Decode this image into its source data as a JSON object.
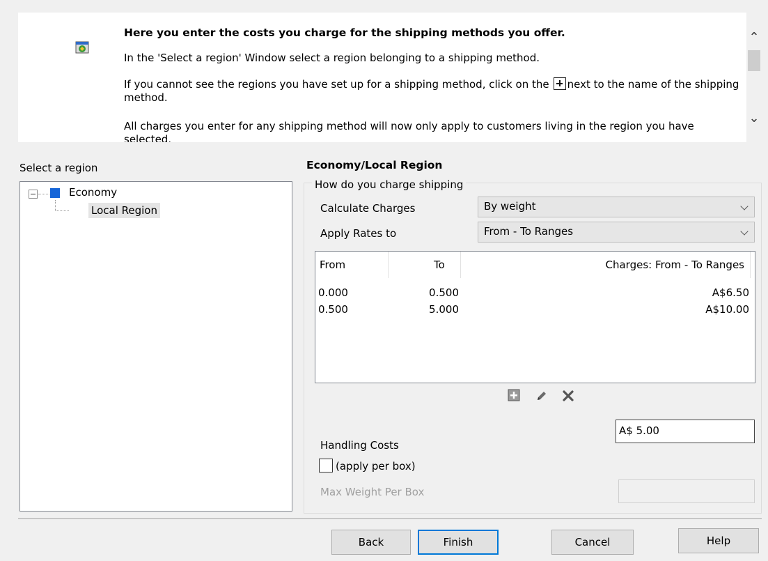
{
  "info": {
    "heading": "Here you enter the costs you charge for the shipping methods you offer.",
    "line_1": "In the 'Select a region' Window select a region belonging to a shipping method.",
    "line_2_before": "If you cannot see the regions you have set up for a shipping method, click on the",
    "line_2_after": "next to the name of the shipping method.",
    "line_3": "All charges you enter for any shipping method will now only apply to customers living in the region you have selected."
  },
  "region_panel": {
    "label": "Select a region",
    "tree": {
      "root": "Economy",
      "child": "Local Region"
    }
  },
  "settings": {
    "section_title": "Economy/Local Region",
    "group_legend": "How do you charge shipping",
    "calculate_label": "Calculate Charges",
    "calculate_value": "By weight",
    "apply_label": "Apply Rates to",
    "apply_value": "From - To Ranges",
    "table": {
      "headers": {
        "from": "From",
        "to": "To",
        "charges": "Charges:  From - To Ranges"
      },
      "rows": [
        {
          "from": "0.000",
          "to": "0.500",
          "charge": "A$6.50"
        },
        {
          "from": "0.500",
          "to": "5.000",
          "charge": "A$10.00"
        }
      ]
    },
    "handling_label": "Handling Costs",
    "handling_value": "A$ 5.00",
    "apply_per_box_label": "(apply per box)",
    "max_weight_label": "Max Weight Per Box",
    "max_weight_value": ""
  },
  "buttons": {
    "back": "Back",
    "finish": "Finish",
    "cancel": "Cancel",
    "help": "Help"
  },
  "colors": {
    "tree_node": "#1565d8",
    "default_button_border": "#0078d7"
  }
}
